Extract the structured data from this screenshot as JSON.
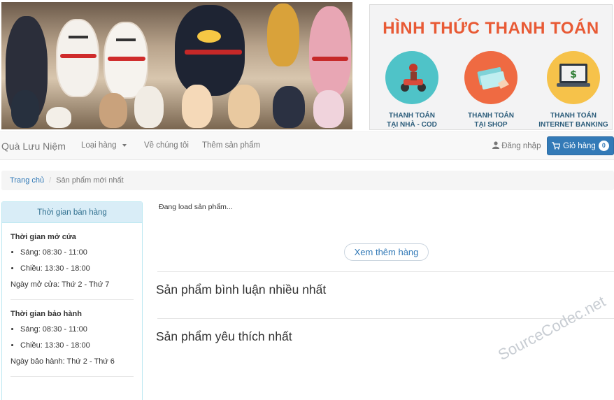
{
  "banner": {
    "payment_title": "HÌNH THỨC THANH TOÁN",
    "payment_options": [
      {
        "line1": "THANH TOÁN",
        "line2": "TẠI NHÀ - COD",
        "icon": "delivery-scooter-icon",
        "color": "#4fc3c8"
      },
      {
        "line1": "THANH TOÁN",
        "line2": "TẠI SHOP",
        "icon": "cash-hand-icon",
        "color": "#ef6a42"
      },
      {
        "line1": "THANH TOÁN",
        "line2": "INTERNET BANKING",
        "icon": "laptop-dollar-icon",
        "color": "#f6c24a"
      }
    ]
  },
  "navbar": {
    "brand": "Quà Lưu Niệm",
    "links": [
      "Loại hàng",
      "Về chúng tôi",
      "Thêm sản phẩm"
    ],
    "login": "Đăng nhập",
    "cart_label": "Giỏ hàng",
    "cart_count": "0"
  },
  "breadcrumb": {
    "home": "Trang chủ",
    "current": "Sản phẩm mới nhất"
  },
  "sidebar": {
    "heading": "Thời gian bán hàng",
    "open_title": "Thời gian mở cửa",
    "open_items": [
      "Sáng: 08:30 - 11:00",
      "Chiều: 13:30 - 18:00"
    ],
    "open_days": "Ngày mở cửa: Thứ 2 - Thứ 7",
    "warranty_title": "Thời gian bảo hành",
    "warranty_items": [
      "Sáng: 08:30 - 11:00",
      "Chiều: 13:30 - 18:00"
    ],
    "warranty_days": "Ngày bảo hành: Thứ 2 - Thứ 6"
  },
  "main": {
    "loading": "Đang load sản phẩm...",
    "more_button": "Xem thêm hàng",
    "most_commented": "Sản phẩm bình luận nhiều nhất",
    "most_liked": "Sản phẩm yêu thích nhất"
  },
  "watermark": "SourceCodec.net",
  "colors": {
    "primary": "#337ab7",
    "panel_heading_bg": "#d9edf7",
    "payment_title": "#e85a35"
  }
}
